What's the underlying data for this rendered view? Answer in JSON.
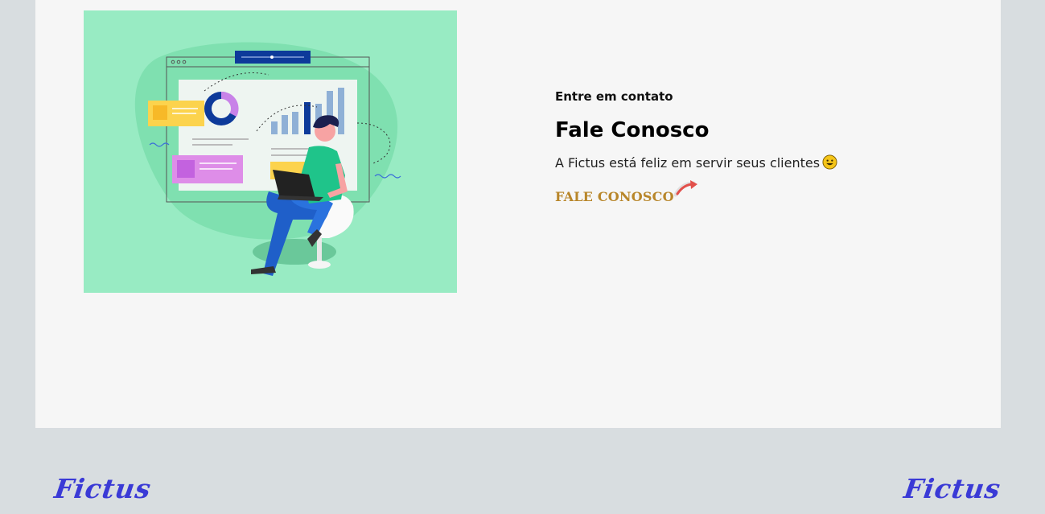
{
  "contact": {
    "eyebrow": "Entre em contato",
    "title": "Fale Conosco",
    "description": "A Fictus está feliz em servir seus clientes",
    "description_emoji": "smiling-face-icon",
    "cta_label": "FALE CONOSCO",
    "cta_icon": "red-arrow-icon"
  },
  "footer": {
    "brand_left": "Fictus",
    "brand_right": "Fictus"
  },
  "colors": {
    "page_background": "#d8dde0",
    "card_background": "#f6f6f6",
    "illustration_background": "#98ebc3",
    "cta_color": "#b8862a",
    "brand_color": "#3a3ad6"
  }
}
